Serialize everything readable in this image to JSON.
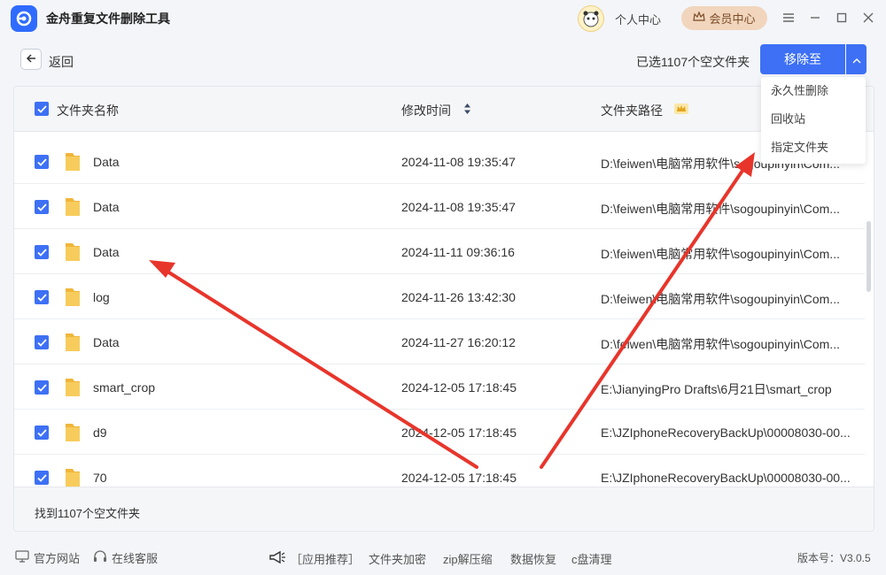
{
  "app": {
    "title": "金舟重复文件删除工具",
    "personal_center": "个人中心",
    "vip_center": "会员中心"
  },
  "toolbar": {
    "back_label": "返回",
    "selected_text": "已选1107个空文件夹",
    "move_button": "移除至"
  },
  "dropdown": {
    "items": [
      "永久性删除",
      "回收站",
      "指定文件夹"
    ]
  },
  "table": {
    "headers": {
      "name": "文件夹名称",
      "time": "修改时间",
      "path": "文件夹路径"
    },
    "rows": [
      {
        "name": "Data",
        "time": "2024-11-08 19:35:47",
        "path": "D:\\feiwen\\电脑常用软件\\sogoupinyin\\Com..."
      },
      {
        "name": "Data",
        "time": "2024-11-08 19:35:47",
        "path": "D:\\feiwen\\电脑常用软件\\sogoupinyin\\Com..."
      },
      {
        "name": "Data",
        "time": "2024-11-11 09:36:16",
        "path": "D:\\feiwen\\电脑常用软件\\sogoupinyin\\Com..."
      },
      {
        "name": "log",
        "time": "2024-11-26 13:42:30",
        "path": "D:\\feiwen\\电脑常用软件\\sogoupinyin\\Com..."
      },
      {
        "name": "Data",
        "time": "2024-11-27 16:20:12",
        "path": "D:\\feiwen\\电脑常用软件\\sogoupinyin\\Com..."
      },
      {
        "name": "smart_crop",
        "time": "2024-12-05 17:18:45",
        "path": "E:\\JianyingPro Drafts\\6月21日\\smart_crop"
      },
      {
        "name": "d9",
        "time": "2024-12-05 17:18:45",
        "path": "E:\\JZIphoneRecoveryBackUp\\00008030-00..."
      },
      {
        "name": "70",
        "time": "2024-12-05 17:18:45",
        "path": "E:\\JZIphoneRecoveryBackUp\\00008030-00..."
      }
    ],
    "found_text": "找到1107个空文件夹"
  },
  "bottom": {
    "official_site": "官方网站",
    "online_service": "在线客服",
    "recommend": "［应用推荐］",
    "links": [
      "文件夹加密",
      "zip解压缩",
      "数据恢复",
      "c盘清理"
    ],
    "version": "版本号：V3.0.5"
  },
  "colors": {
    "accent": "#3d70f5",
    "annotation_arrow": "#e8352b",
    "folder": "#f5c044"
  }
}
